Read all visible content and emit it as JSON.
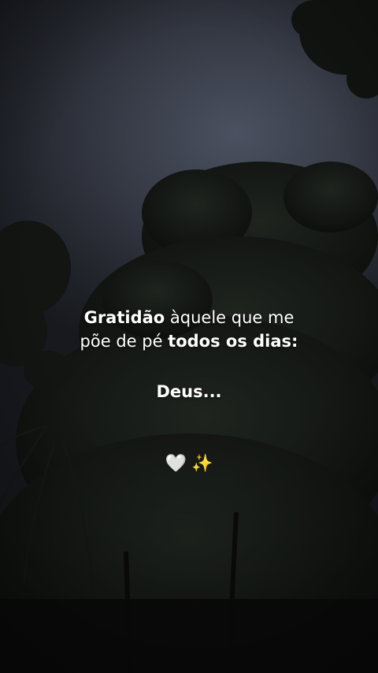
{
  "caption": {
    "line1_bold": "Gratidão",
    "line1_rest": " àquele que me",
    "line2_start": "põe de pé ",
    "line2_bold": "todos os dias:"
  },
  "signature": "Deus...",
  "emojis": {
    "heart": "🤍",
    "sparkles": "✨"
  }
}
